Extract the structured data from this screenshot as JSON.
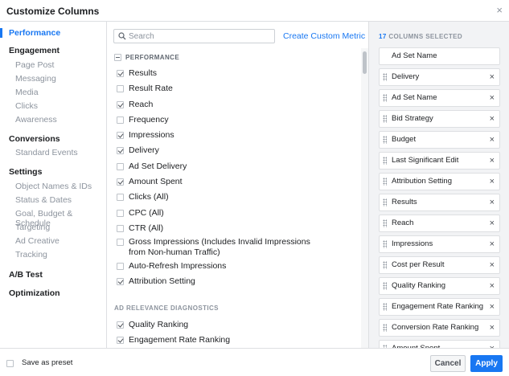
{
  "dialog": {
    "title": "Customize Columns",
    "close_glyph": "×"
  },
  "sidebar": {
    "items": [
      {
        "label": "Performance",
        "kind": "active"
      },
      {
        "label": "Engagement",
        "kind": "head"
      },
      {
        "label": "Page Post",
        "kind": "sub"
      },
      {
        "label": "Messaging",
        "kind": "sub"
      },
      {
        "label": "Media",
        "kind": "sub"
      },
      {
        "label": "Clicks",
        "kind": "sub"
      },
      {
        "label": "Awareness",
        "kind": "sub"
      },
      {
        "label": "Conversions",
        "kind": "head"
      },
      {
        "label": "Standard Events",
        "kind": "sub"
      },
      {
        "label": "Settings",
        "kind": "head"
      },
      {
        "label": "Object Names & IDs",
        "kind": "sub"
      },
      {
        "label": "Status & Dates",
        "kind": "sub"
      },
      {
        "label": "Goal, Budget & Schedule",
        "kind": "sub"
      },
      {
        "label": "Targeting",
        "kind": "sub"
      },
      {
        "label": "Ad Creative",
        "kind": "sub"
      },
      {
        "label": "Tracking",
        "kind": "sub"
      },
      {
        "label": "A/B Test",
        "kind": "head"
      },
      {
        "label": "Optimization",
        "kind": "head"
      }
    ]
  },
  "search": {
    "placeholder": "Search",
    "value": ""
  },
  "create_metric_label": "Create Custom Metric",
  "performance": {
    "heading": "PERFORMANCE",
    "options": [
      {
        "label": "Results",
        "checked": true
      },
      {
        "label": "Result Rate",
        "checked": false
      },
      {
        "label": "Reach",
        "checked": true
      },
      {
        "label": "Frequency",
        "checked": false
      },
      {
        "label": "Impressions",
        "checked": true
      },
      {
        "label": "Delivery",
        "checked": true
      },
      {
        "label": "Ad Set Delivery",
        "checked": false
      },
      {
        "label": "Amount Spent",
        "checked": true
      },
      {
        "label": "Clicks (All)",
        "checked": false
      },
      {
        "label": "CPC (All)",
        "checked": false
      },
      {
        "label": "CTR (All)",
        "checked": false
      },
      {
        "label": "Gross Impressions (Includes Invalid Impressions",
        "label2": "from Non-human Traffic)",
        "checked": false
      },
      {
        "label": "Auto-Refresh Impressions",
        "checked": false
      },
      {
        "label": "Attribution Setting",
        "checked": true
      }
    ]
  },
  "relevance": {
    "heading": "AD RELEVANCE DIAGNOSTICS",
    "options": [
      {
        "label": "Quality Ranking",
        "checked": true
      },
      {
        "label": "Engagement Rate Ranking",
        "checked": true
      }
    ]
  },
  "selected": {
    "count": "17",
    "count_label": "COLUMNS SELECTED",
    "columns": [
      {
        "label": "Ad Set Name",
        "locked": true
      },
      {
        "label": "Delivery",
        "locked": false
      },
      {
        "label": "Ad Set Name",
        "locked": false
      },
      {
        "label": "Bid Strategy",
        "locked": false
      },
      {
        "label": "Budget",
        "locked": false
      },
      {
        "label": "Last Significant Edit",
        "locked": false
      },
      {
        "label": "Attribution Setting",
        "locked": false
      },
      {
        "label": "Results",
        "locked": false
      },
      {
        "label": "Reach",
        "locked": false
      },
      {
        "label": "Impressions",
        "locked": false
      },
      {
        "label": "Cost per Result",
        "locked": false
      },
      {
        "label": "Quality Ranking",
        "locked": false
      },
      {
        "label": "Engagement Rate Ranking",
        "locked": false
      },
      {
        "label": "Conversion Rate Ranking",
        "locked": false
      },
      {
        "label": "Amount Spent",
        "locked": false
      }
    ],
    "remove_glyph": "×"
  },
  "footer": {
    "preset_label": "Save as preset",
    "cancel_label": "Cancel",
    "apply_label": "Apply"
  }
}
